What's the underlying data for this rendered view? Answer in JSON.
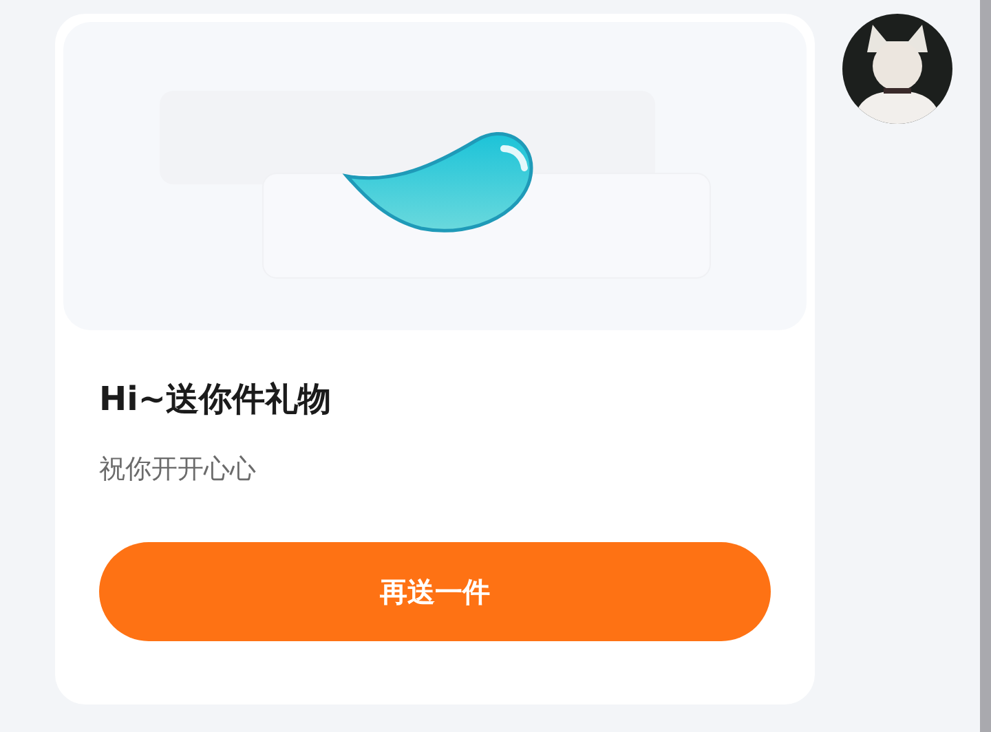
{
  "gift_card": {
    "title": "Hi~送你件礼物",
    "message": "祝你开开心心",
    "button": "再送一件"
  }
}
